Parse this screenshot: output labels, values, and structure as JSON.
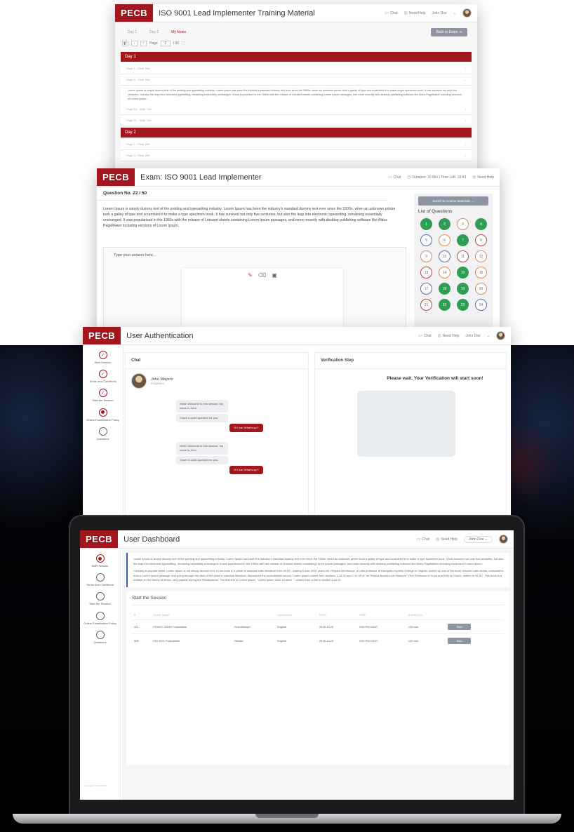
{
  "brand": {
    "logo": "PECB",
    "accent": "#a4161e",
    "grey_button": "#8e94a1",
    "green": "#2f9e55"
  },
  "header_common": {
    "chat": "Chat",
    "need_help": "Need Help",
    "user": "John Doe"
  },
  "training": {
    "title": "ISO 9001 Lead Implementer Training Material",
    "tabs": [
      "Day 1",
      "Day 2",
      "My Notes"
    ],
    "back_label": "Back to Exam",
    "page_label": "Page",
    "page_value": "1",
    "page_total": "/ 50",
    "day1": "Day 1",
    "day2": "Day 2",
    "slides": [
      "Page 1 - Slide Title",
      "Page 5 - Slide Title",
      "Page 16 - Slide Title",
      "Page 21 - Slide Title",
      "Page 1 - Slide Title",
      "Page 3 - Slide Title"
    ],
    "body": "Lorem Ipsum is simply dummy text of the printing and typesetting industry. Lorem Ipsum has been the industry's standard dummy text ever since the 1500s, when an unknown printer took a galley of type and scrambled it to make a type specimen book. It has survived not only five centuries, but also the leap into electronic typesetting, remaining essentially unchanged. It was popularised in the 1960s with the release of Letraset sheets containing Lorem Ipsum passages, and more recently with desktop publishing software like Aldus PageMaker including versions of Lorem Ipsum."
  },
  "exam": {
    "title": "Exam: ISO 9001 Lead Implementer",
    "duration": "Duration: 20 Min | Time Left: 18:43",
    "question_no": "Question No. 22 / 50",
    "question_text": "Lorem Ipsum is simply dummy text of the printing and typesetting industry. Lorem Ipsum has been the industry's standard dummy text ever since the 1500s, when an unknown printer took a galley of type and scrambled it to make a type specimen book. It has survived not only five centuries, but also the leap into electronic typesetting, remaining essentially unchanged. It was popularised in the 1960s with the release of Letraset sheets containing Lorem Ipsum passages, and more recently with desktop publishing software like Aldus PageMaker including versions of Lorem Ipsum.",
    "answer_placeholder": "Type your answer here...",
    "switch_label": "Switch to Course Materials",
    "list_title": "List of Questions",
    "questions": [
      {
        "n": "1",
        "s": "g"
      },
      {
        "n": "2",
        "s": "g"
      },
      {
        "n": "3",
        "s": "o"
      },
      {
        "n": "4",
        "s": "g"
      },
      {
        "n": "5",
        "s": "b"
      },
      {
        "n": "6",
        "s": "o"
      },
      {
        "n": "7",
        "s": "g"
      },
      {
        "n": "8",
        "s": "r"
      },
      {
        "n": "9",
        "s": "o"
      },
      {
        "n": "10",
        "s": "b"
      },
      {
        "n": "11",
        "s": "r"
      },
      {
        "n": "12",
        "s": "o"
      },
      {
        "n": "13",
        "s": "r"
      },
      {
        "n": "14",
        "s": "o"
      },
      {
        "n": "15",
        "s": "g"
      },
      {
        "n": "16",
        "s": "o"
      },
      {
        "n": "17",
        "s": "b"
      },
      {
        "n": "18",
        "s": "g"
      },
      {
        "n": "19",
        "s": "g"
      },
      {
        "n": "20",
        "s": "o"
      },
      {
        "n": "21",
        "s": "r"
      },
      {
        "n": "22",
        "s": "g"
      },
      {
        "n": "23",
        "s": "g"
      },
      {
        "n": "24",
        "s": "b"
      }
    ]
  },
  "auth": {
    "title": "User Authentication",
    "steps": [
      "Start Session",
      "Terms and Conditions",
      "Start the Session",
      "Online Examination Policy",
      "Questions"
    ],
    "chat_title": "Chat",
    "agent_name": "John Mayers",
    "agent_role": "Invigilator",
    "msg1": "Hello! Welcome to this session. My name is John",
    "msg2": "I have a quick question for you.",
    "reply": "Hi I am 'What's up?'",
    "verif_title": "Verification Step",
    "verif_wait": "Please wait. Your Verification will start soon!"
  },
  "dashboard": {
    "title": "User Dashboard",
    "steps": [
      "Start Session",
      "Terms and Conditions",
      "Start the Session",
      "Online Examination Policy",
      "Questions"
    ],
    "intro1": "Lorem Ipsum is simply dummy text of the printing and typesetting industry. Lorem Ipsum has been the industry's standard dummy text ever since the 1500s, when an unknown printer took a galley of type and scrambled it to make a type specimen book. It has survived not only five centuries, but also the leap into electronic typesetting, remaining essentially unchanged. It was popularised in the 1960s with the release of Letraset sheets containing Lorem Ipsum passages, and more recently with desktop publishing software like Aldus PageMaker including versions of Lorem Ipsum.",
    "intro2": "Contrary to popular belief, Lorem Ipsum is not simply random text. It has roots in a piece of classical Latin literature from 45 BC, making it over 2000 years old. Richard McClintock, a Latin professor at Hampden-Sydney College in Virginia, looked up one of the more obscure Latin words, consectetur, from a Lorem Ipsum passage, and going through the cites of the word in classical literature, discovered the undoubtable source. Lorem Ipsum comes from sections 1.10.32 and 1.10.33 of \"de Finibus Bonorum et Malorum\" (The Extremes of Good and Evil) by Cicero, written in 45 BC. This book is a treatise on the theory of ethics, very popular during the Renaissance. The first line of Lorem Ipsum, \"Lorem ipsum dolor sit amet..\", comes from a line in section 1.10.32.",
    "session_title": "Start the Session",
    "columns": [
      "#",
      "EXAM NAME",
      "",
      "LANGUAGE",
      "DATE",
      "TIME",
      "DURATION",
      ""
    ],
    "rows": [
      {
        "id": "421",
        "name": "ISO/IEC 20000 Foundation",
        "type": "First Attempt",
        "lang": "English",
        "date": "2018-10-24",
        "time": "3:00 PM CEST",
        "dur": "120 min",
        "btn": "Start"
      },
      {
        "id": "505",
        "name": "ISO 9001 Foundation",
        "type": "Retake",
        "lang": "English",
        "date": "2018-10-24",
        "time": "3:00 PM CEST",
        "dur": "120 min",
        "btn": "Start"
      }
    ],
    "copyright": "Copyright © 2018 PECB"
  }
}
